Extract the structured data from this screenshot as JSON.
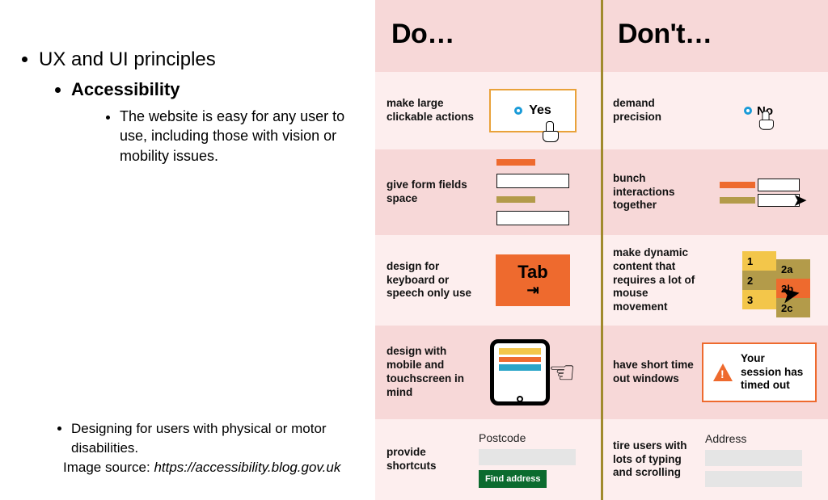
{
  "left": {
    "lvl1": "UX and UI principles",
    "lvl2": "Accessibility",
    "lvl3": "The website is easy for any user to use, including those with vision or mobility issues.",
    "caption": "Designing for users with physical or motor disabilities.",
    "source_prefix": "Image source: ",
    "source_url": "https://accessibility.blog.gov.uk"
  },
  "headers": {
    "do": "Do…",
    "dont": "Don't…"
  },
  "rows": [
    {
      "do_label": "make large clickable actions",
      "dont_label": "demand precision",
      "yes_text": "Yes",
      "no_text": "No"
    },
    {
      "do_label": "give form fields space",
      "dont_label": "bunch interactions together"
    },
    {
      "do_label": "design for keyboard or speech only use",
      "dont_label": "make dynamic content that requires a lot of mouse movement",
      "tab_text": "Tab",
      "menu": [
        "1",
        "2",
        "3"
      ],
      "submenu": [
        "2a",
        "2b",
        "2c"
      ]
    },
    {
      "do_label": "design with mobile and touchscreen in mind",
      "dont_label": "have short time out windows",
      "timeout_text": "Your session has timed out"
    },
    {
      "do_label": "provide shortcuts",
      "dont_label": "tire users with lots of typing and scrolling",
      "postcode_label": "Postcode",
      "find_btn": "Find address",
      "address_label": "Address"
    }
  ]
}
